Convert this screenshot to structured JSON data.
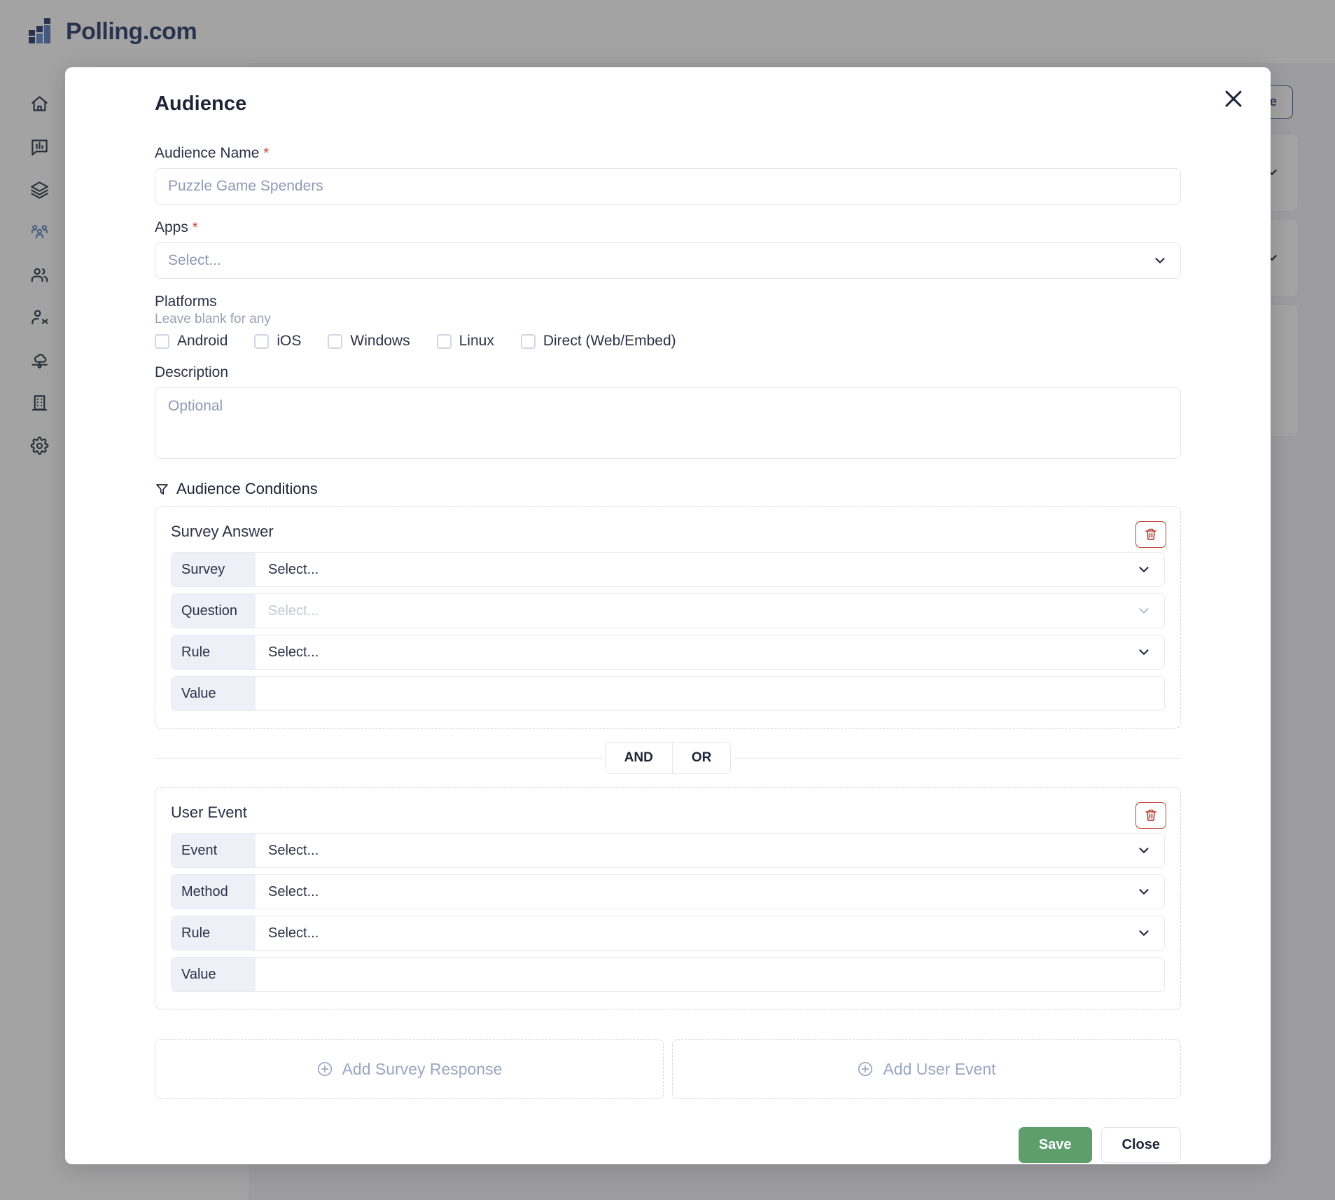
{
  "brand": {
    "name": "Polling.com",
    "logo_icon": "bar-chart-logo-icon"
  },
  "sidebar": {
    "items": [
      {
        "icon": "home-icon",
        "name": "home",
        "active": false
      },
      {
        "icon": "chart-message-icon",
        "name": "surveys",
        "active": false
      },
      {
        "icon": "layers-icon",
        "name": "layers",
        "active": false
      },
      {
        "icon": "audience-group-icon",
        "name": "audiences",
        "active": true
      },
      {
        "icon": "users-icon",
        "name": "users",
        "active": false
      },
      {
        "icon": "user-code-icon",
        "name": "developers",
        "active": false
      },
      {
        "icon": "cloud-network-icon",
        "name": "integrations",
        "active": false
      },
      {
        "icon": "building-icon",
        "name": "organization",
        "active": false
      },
      {
        "icon": "gear-icon",
        "name": "settings",
        "active": false
      }
    ]
  },
  "background_page": {
    "create_button_label": "nce",
    "chevron_icon": "chevron-down-icon"
  },
  "modal": {
    "title": "Audience",
    "close_icon": "close-icon",
    "audience_name": {
      "label": "Audience Name",
      "required_marker": "*",
      "value": "",
      "placeholder": "Puzzle Game Spenders"
    },
    "apps": {
      "label": "Apps",
      "required_marker": "*",
      "selected": "Select...",
      "chevron_icon": "chevron-down-icon"
    },
    "platforms": {
      "label": "Platforms",
      "hint": "Leave blank for any",
      "options": [
        {
          "label": "Android",
          "checked": false
        },
        {
          "label": "iOS",
          "checked": false
        },
        {
          "label": "Windows",
          "checked": false
        },
        {
          "label": "Linux",
          "checked": false
        },
        {
          "label": "Direct (Web/Embed)",
          "checked": false
        }
      ]
    },
    "description": {
      "label": "Description",
      "value": "",
      "placeholder": "Optional"
    },
    "conditions": {
      "header": "Audience Conditions",
      "header_icon": "filter-icon",
      "blocks": [
        {
          "title": "Survey Answer",
          "delete_icon": "trash-icon",
          "rows": [
            {
              "key": "Survey",
              "value": "Select...",
              "type": "select",
              "disabled": false
            },
            {
              "key": "Question",
              "value": "Select...",
              "type": "select",
              "disabled": true
            },
            {
              "key": "Rule",
              "value": "Select...",
              "type": "select",
              "disabled": false
            },
            {
              "key": "Value",
              "value": "",
              "type": "text",
              "disabled": false
            }
          ]
        },
        {
          "title": "User Event",
          "delete_icon": "trash-icon",
          "rows": [
            {
              "key": "Event",
              "value": "Select...",
              "type": "select",
              "disabled": false
            },
            {
              "key": "Method",
              "value": "Select...",
              "type": "select",
              "disabled": false
            },
            {
              "key": "Rule",
              "value": "Select...",
              "type": "select",
              "disabled": false
            },
            {
              "key": "Value",
              "value": "",
              "type": "text",
              "disabled": false
            }
          ]
        }
      ],
      "operator": {
        "and_label": "AND",
        "or_label": "OR",
        "selected": "AND"
      }
    },
    "add_buttons": [
      {
        "label": "Add Survey Response",
        "icon": "plus-circle-icon"
      },
      {
        "label": "Add User Event",
        "icon": "plus-circle-icon"
      }
    ],
    "footer": {
      "save_label": "Save",
      "close_label": "Close"
    }
  },
  "colors": {
    "brand_navy": "#1c2d5e",
    "accent_blue": "#5a7fc0",
    "save_green": "#5d9e6c",
    "danger_red": "#b33a33",
    "required_red": "#d1453b"
  }
}
